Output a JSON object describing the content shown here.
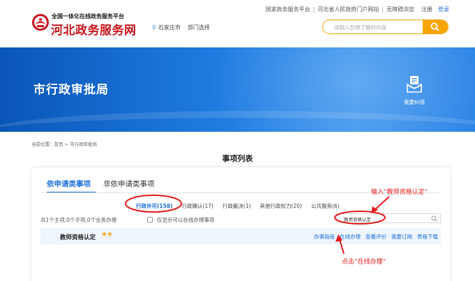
{
  "top_links": {
    "national": "国家政务服务平台",
    "province_portal": "河北省人民政府门户网站",
    "barrier_free": "无障碍浏览",
    "register": "注册",
    "login": "登录"
  },
  "logo": {
    "subtitle": "全国一体化在线政务服务平台",
    "title": "河北政务服务网"
  },
  "location": {
    "city": "石家庄市",
    "dept_select": "部门选择"
  },
  "search": {
    "placeholder": "请输入您想了解的内容"
  },
  "banner": {
    "title": "市行政审批局",
    "report_label": "我要纠错"
  },
  "breadcrumb": "当前位置：首页 > 市行政审批局",
  "page_title": "事项列表",
  "tabs": [
    {
      "label": "依申请类事项",
      "active": true
    },
    {
      "label": "非依申请类事项",
      "active": false
    }
  ],
  "categories": [
    {
      "label": "行政许可(158)",
      "active": true
    },
    {
      "label": "行政确认(17)",
      "active": false
    },
    {
      "label": "行政裁决(1)",
      "active": false
    },
    {
      "label": "其他行政权力(20)",
      "active": false
    },
    {
      "label": "公共服务(6)",
      "active": false
    }
  ],
  "summary": "共1个主项,0个子项,0个业务办理",
  "only_online_label": "仅显示可以在线办理事项",
  "inner_search_value": "教师资格认定",
  "item": {
    "name": "教师资格认定",
    "stars": "★★",
    "actions": [
      "办事指南",
      "在线办理",
      "查看评价",
      "我要订阅",
      "表格下载"
    ]
  },
  "annotations": {
    "input_hint": "输入“教师资格认定”",
    "click_hint": "点击“在线办理”",
    "color": "#e41b1b"
  },
  "colors": {
    "brand_red": "#c8161d",
    "accent_blue": "#1e6fd9",
    "search_orange": "#f7a600"
  }
}
